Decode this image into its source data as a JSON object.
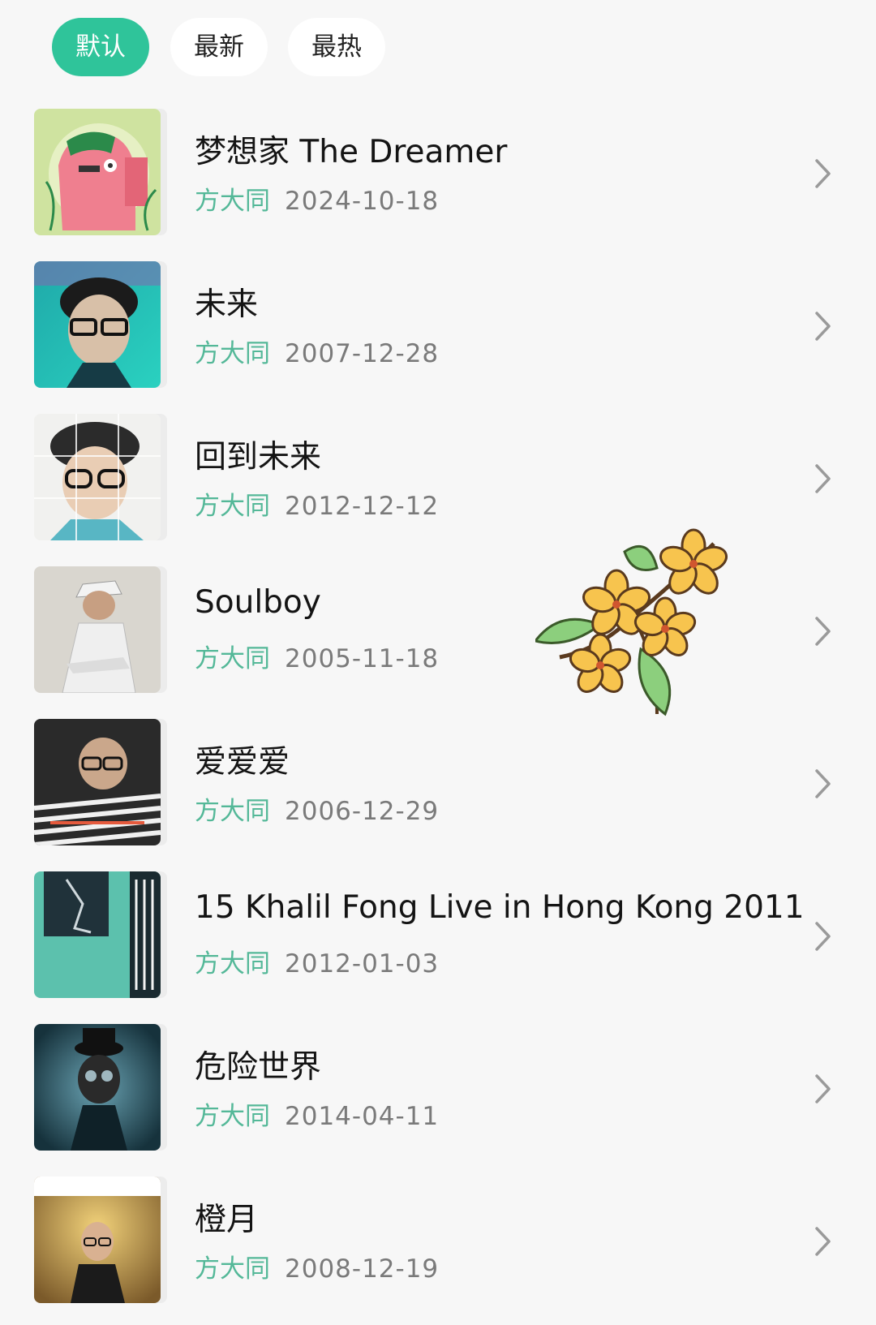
{
  "sort_tabs": [
    {
      "label": "默认",
      "active": true
    },
    {
      "label": "最新",
      "active": false
    },
    {
      "label": "最热",
      "active": false
    }
  ],
  "albums": [
    {
      "title": "梦想家 The Dreamer",
      "artist": "方大同",
      "date": "2024-10-18"
    },
    {
      "title": "未来",
      "artist": "方大同",
      "date": "2007-12-28"
    },
    {
      "title": "回到未来",
      "artist": "方大同",
      "date": "2012-12-12"
    },
    {
      "title": "Soulboy",
      "artist": "方大同",
      "date": "2005-11-18"
    },
    {
      "title": "爱爱爱",
      "artist": "方大同",
      "date": "2006-12-29"
    },
    {
      "title": "15 Khalil Fong Live in Hong Kong 2011",
      "artist": "方大同",
      "date": "2012-01-03"
    },
    {
      "title": "危险世界",
      "artist": "方大同",
      "date": "2014-04-11"
    },
    {
      "title": "橙月",
      "artist": "方大同",
      "date": "2008-12-19"
    }
  ],
  "colors": {
    "accent": "#2fc49a",
    "artist_text": "#54b898",
    "date_text": "#7a7a7a",
    "background": "#f7f7f7"
  },
  "icons": {
    "row_arrow": "chevron-right-icon",
    "decoration": "osmanthus-flower-sticker"
  }
}
